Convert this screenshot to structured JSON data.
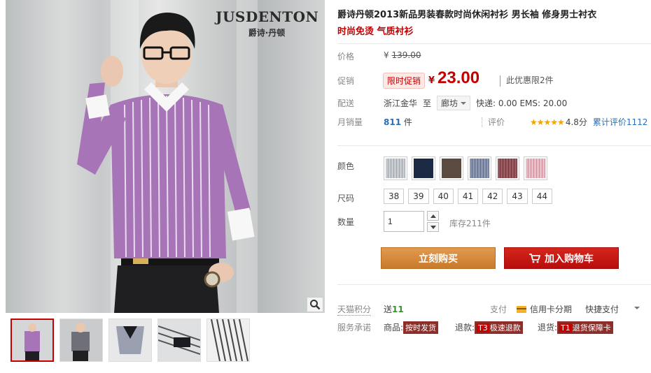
{
  "product": {
    "title": "爵诗丹顿2013新品男装春款时尚休闲衬衫 男长袖 修身男士衬衣",
    "subtitle": "时尚免烫 气质衬衫",
    "brand_name": "JUSDENTON",
    "brand_sub": "爵诗·丹顿"
  },
  "price": {
    "label": "价格",
    "original": "139.00",
    "currency": "¥"
  },
  "promo": {
    "label": "促销",
    "tag": "限时促销",
    "currency": "¥",
    "price": "23.00",
    "limit_text": "此优惠限2件"
  },
  "shipping": {
    "label": "配送",
    "from": "浙江金华",
    "to_word": "至",
    "destination": "廊坊",
    "fees": "快递: 0.00 EMS: 20.00"
  },
  "sales": {
    "label": "月销量",
    "count": "811",
    "unit": "件",
    "rating_label": "评价",
    "stars": "★★★★★",
    "score": "4.8分",
    "reviews": "累计评价1112"
  },
  "options": {
    "color_label": "颜色",
    "colors": [
      {
        "name": "light-grey-stripe",
        "hex": "#b9bcc2"
      },
      {
        "name": "navy",
        "hex": "#1d2a44"
      },
      {
        "name": "dark-brown",
        "hex": "#5a4a40"
      },
      {
        "name": "blue-grey-stripe",
        "hex": "#7e89a3"
      },
      {
        "name": "maroon-stripe",
        "hex": "#8b4a50"
      },
      {
        "name": "pink-stripe",
        "hex": "#d7a9b3"
      }
    ],
    "size_label": "尺码",
    "sizes": [
      "38",
      "39",
      "40",
      "41",
      "42",
      "43",
      "44"
    ],
    "qty_label": "数量",
    "qty_value": "1",
    "stock": "库存211件"
  },
  "actions": {
    "buy": "立刻购买",
    "cart": "加入购物车"
  },
  "tmall": {
    "points_label": "天猫积分",
    "gift_word": "送",
    "gift_points": "11",
    "pay_label": "支付",
    "pay_card": "信用卡分期",
    "pay_fast": "快捷支付"
  },
  "service": {
    "label": "服务承诺",
    "goods_word": "商品:",
    "goods_tag": "按时发货",
    "refund_word": "退款:",
    "refund_code": "T3",
    "refund_tag": "极速退款",
    "return_word": "退货:",
    "return_code": "T1",
    "return_tag": "退货保障卡"
  },
  "colors": {
    "accent_red": "#c40000",
    "buy_orange": "#d98e3e",
    "cart_red": "#c91a14",
    "link_blue": "#2a6fb5"
  }
}
